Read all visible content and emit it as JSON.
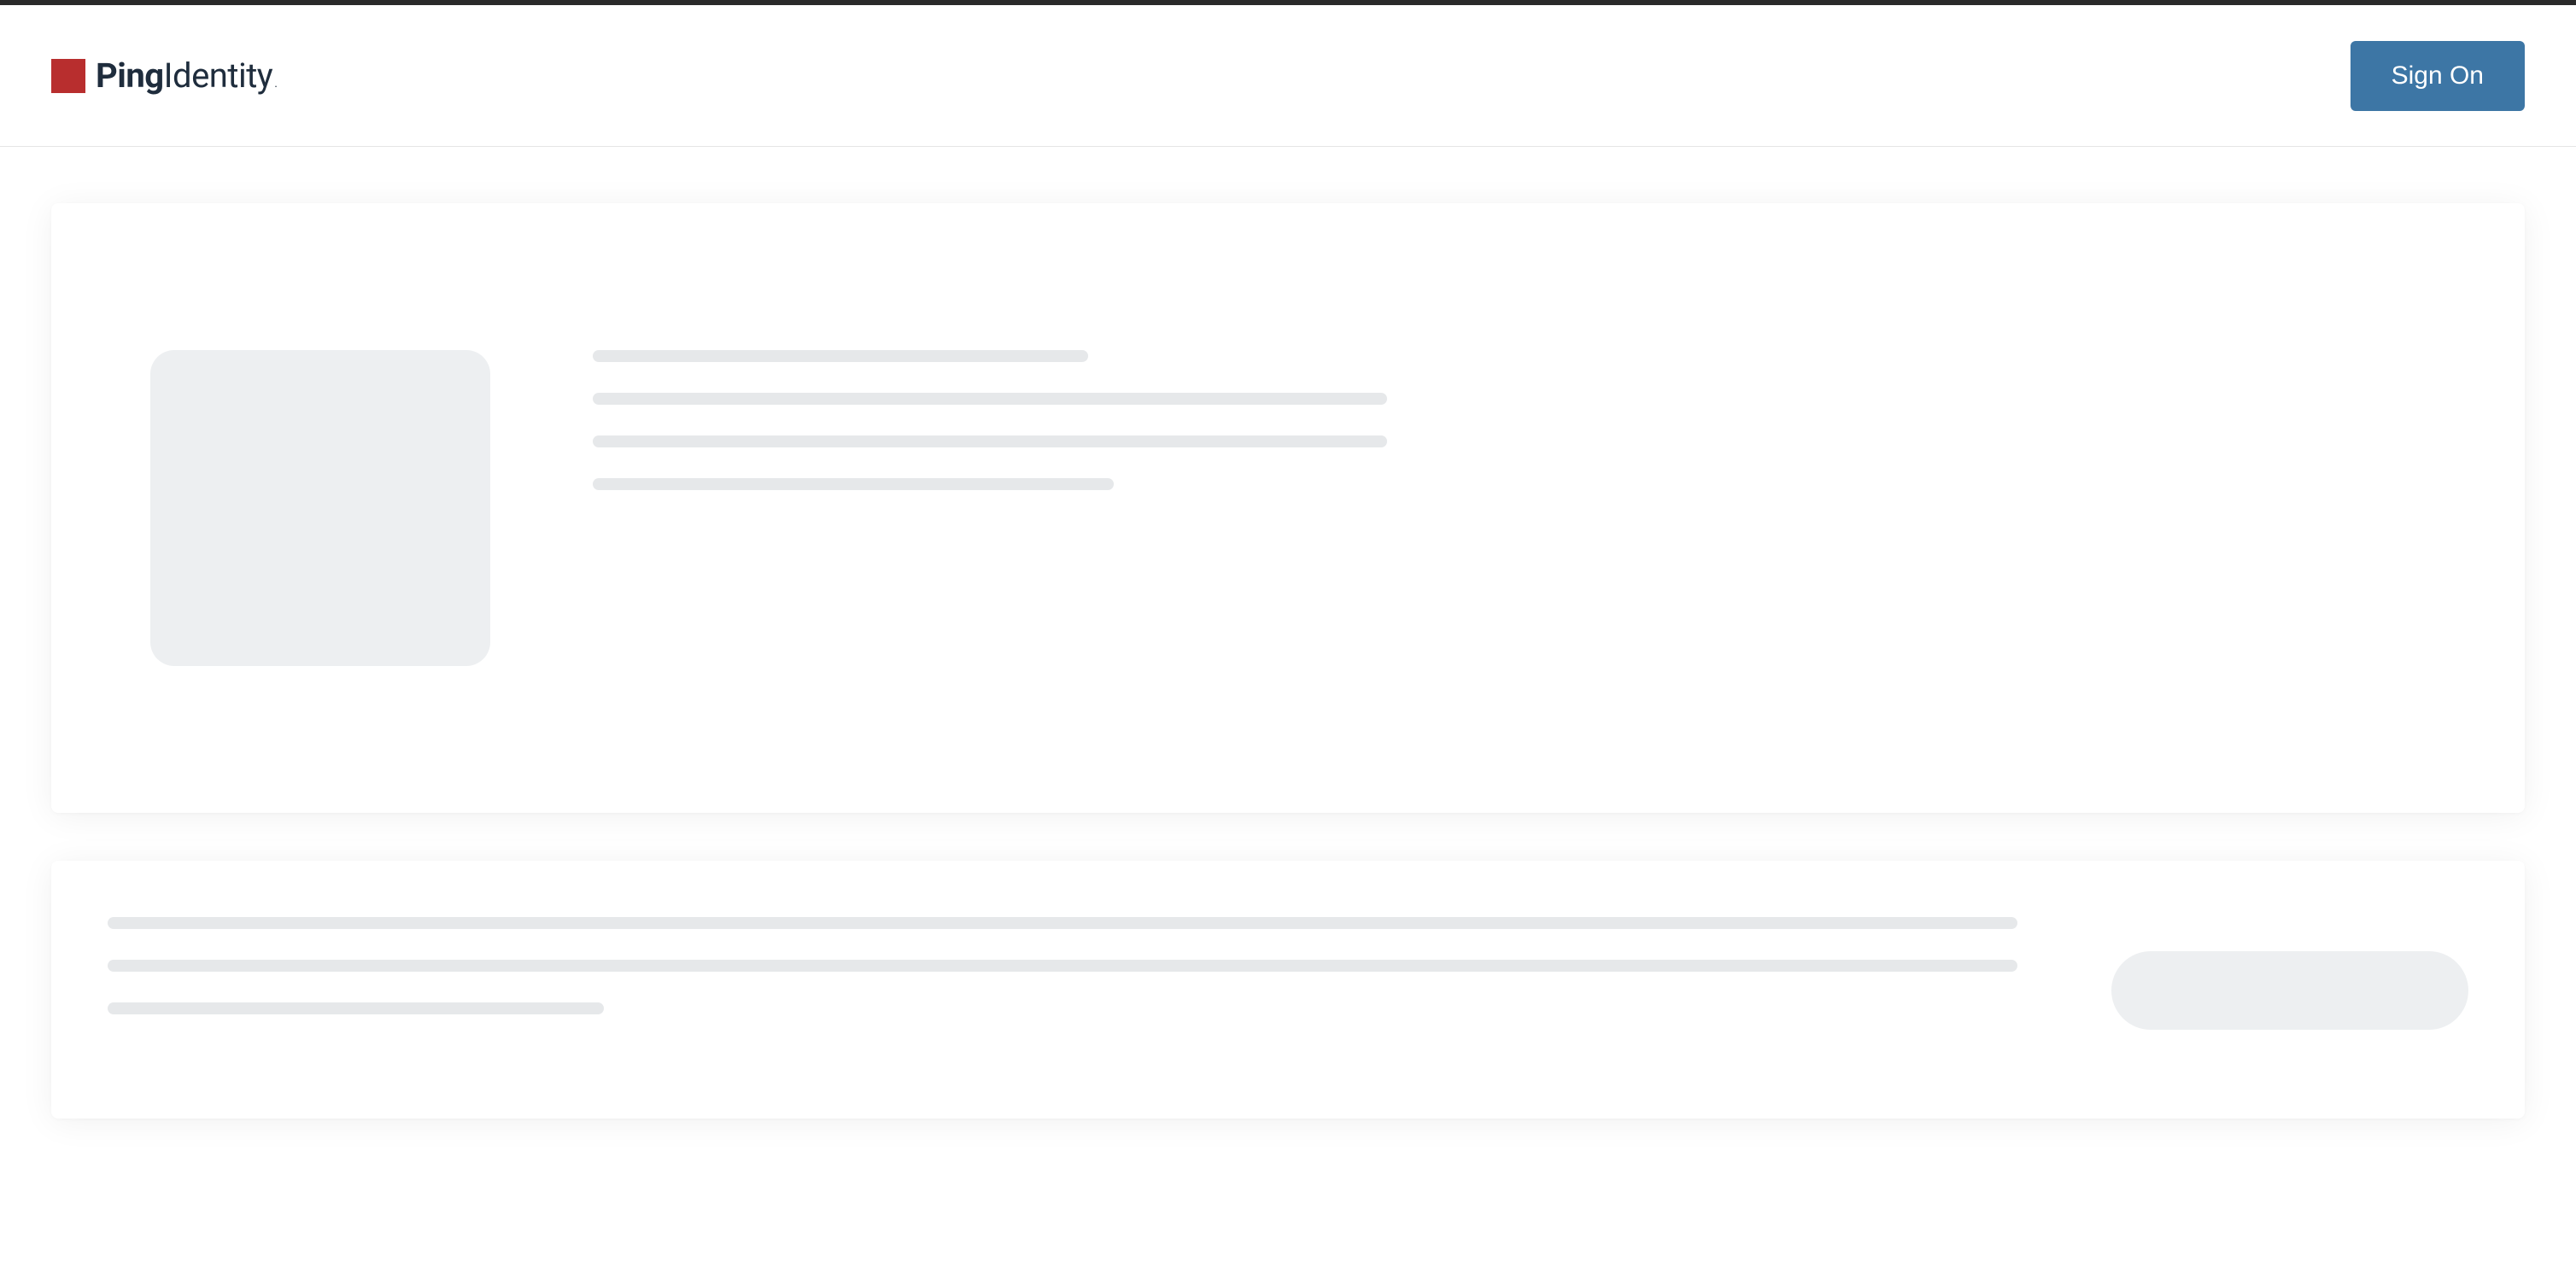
{
  "header": {
    "brand_bold": "Ping",
    "brand_rest": "Identity",
    "brand_suffix": ".",
    "signon_label": "Sign On"
  },
  "colors": {
    "brand_red": "#b82e2e",
    "brand_navy": "#1f2d3d",
    "button_blue": "#3d76a5",
    "skeleton_light": "#edeff1",
    "skeleton_line": "#e6e8ea"
  },
  "state": {
    "loading": true
  }
}
